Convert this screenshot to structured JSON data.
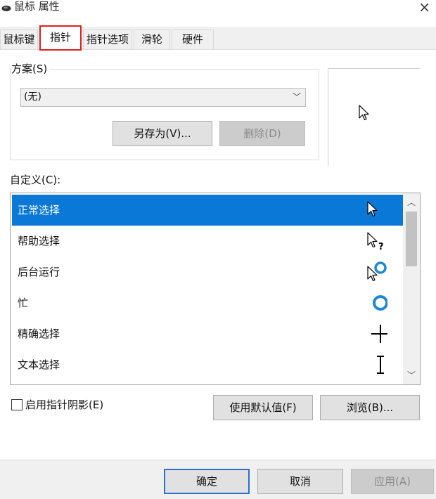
{
  "window": {
    "title": "鼠标 属性",
    "close_glyph": "×"
  },
  "tabs": [
    {
      "label": "鼠标键"
    },
    {
      "label": "指针"
    },
    {
      "label": "指针选项"
    },
    {
      "label": "滑轮"
    },
    {
      "label": "硬件"
    }
  ],
  "scheme": {
    "label": "方案(S)",
    "selected": "(无)",
    "save_as_label": "另存为(V)...",
    "delete_label": "删除(D)"
  },
  "customize": {
    "label": "自定义(C):",
    "items": [
      {
        "label": "正常选择",
        "icon": "normal-select-cursor-icon"
      },
      {
        "label": "帮助选择",
        "icon": "help-select-cursor-icon"
      },
      {
        "label": "后台运行",
        "icon": "working-in-background-cursor-icon"
      },
      {
        "label": "忙",
        "icon": "busy-cursor-icon"
      },
      {
        "label": "精确选择",
        "icon": "precision-select-cursor-icon"
      },
      {
        "label": "文本选择",
        "icon": "text-select-cursor-icon"
      }
    ]
  },
  "options": {
    "shadow_label": "启用指针阴影(E)",
    "use_default_label": "使用默认值(F)",
    "browse_label": "浏览(B)..."
  },
  "footer": {
    "ok_label": "确定",
    "cancel_label": "取消",
    "apply_label": "应用(A)"
  },
  "colors": {
    "selection": "#0a78d7",
    "highlight_border": "#e0201e",
    "busy_ring": "#1e88d8"
  }
}
